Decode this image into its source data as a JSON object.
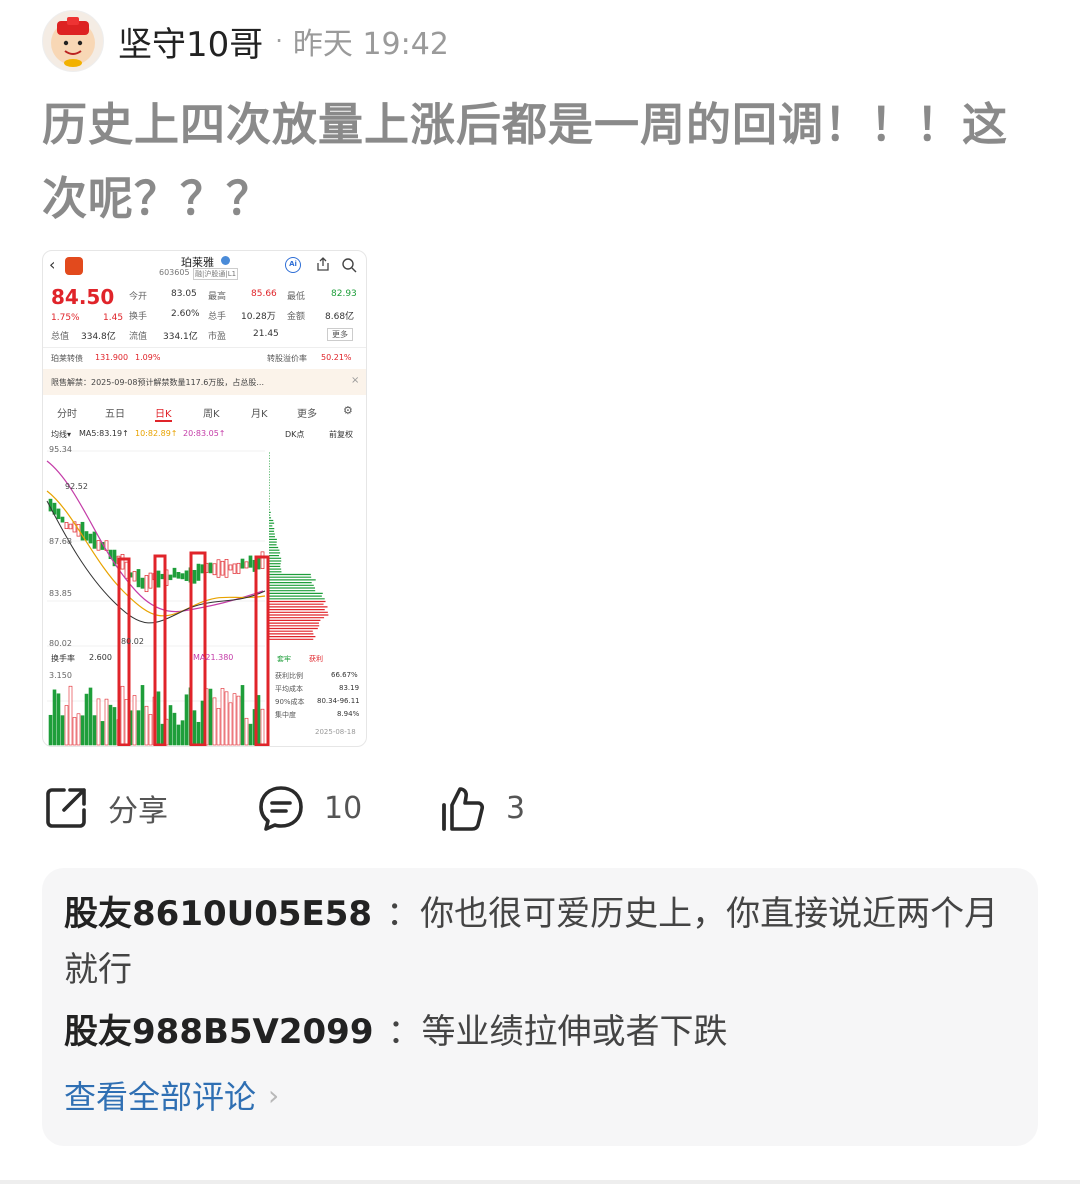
{
  "post": {
    "author": "坚守10哥",
    "separator": "·",
    "time": "昨天 19:42",
    "text": "历史上四次放量上涨后都是一周的回调！！！这次呢？？？"
  },
  "stock_screenshot": {
    "name": "珀莱雅",
    "code": "603605",
    "tag": "融|沪股通|L1",
    "price": "84.50",
    "change_pct": "1.75%",
    "change": "1.45",
    "open_label": "今开",
    "open": "83.05",
    "high_label": "最高",
    "high": "85.66",
    "low_label": "最低",
    "low": "82.93",
    "turnover_label": "换手",
    "turnover": "2.60%",
    "volume_label": "总手",
    "volume": "10.28万",
    "amount_label": "金额",
    "amount": "8.68亿",
    "mcap_label": "总值",
    "mcap": "334.8亿",
    "float_label": "流值",
    "float": "334.1亿",
    "pe_label": "市盈",
    "pe": "21.45",
    "more": "更多",
    "bond_label": "珀莱转债",
    "bond_price": "131.900",
    "bond_pct": "1.09%",
    "premium_label": "转股溢价率",
    "premium": "50.21%",
    "notice": "限售解禁：2025-09-08预计解禁数量117.6万股，占总股...",
    "tabs": [
      "分时",
      "五日",
      "日K",
      "周K",
      "月K",
      "更多"
    ],
    "ma_line": "MA5:83.19↑",
    "ma10": "10:82.89↑",
    "ma20": "20:83.05↑",
    "dk": "DK点",
    "fq": "前复权",
    "price_high": "95.34",
    "mark_high": "92.52",
    "price_mid": "87.68",
    "price_low2": "83.85",
    "price_low": "80.02",
    "mark_low": "80.02",
    "turnover_ind": "换手率",
    "turnover_val": "2.600",
    "ma_ind": "MA21.380",
    "vol_top": "3.150",
    "profit_rows": [
      {
        "label": "获利比例",
        "value": "66.67%"
      },
      {
        "label": "平均成本",
        "value": "83.19"
      },
      {
        "label": "90%成本",
        "value": "80.34-96.11"
      },
      {
        "label": "集中度",
        "value": "8.94%"
      }
    ],
    "legend_a": "套牢",
    "legend_b": "获利",
    "date": "2025-08-18",
    "accent_red": "#e0242a",
    "accent_green": "#1e9e3a"
  },
  "actions": {
    "share": "分享",
    "comment_count": "10",
    "like_count": "3"
  },
  "comments": [
    {
      "user": "股友8610U05E58",
      "sep": "：",
      "text": "你也很可爱历史上，你直接说近两个月就行"
    },
    {
      "user": "股友988B5V2099",
      "sep": "：",
      "text": "等业绩拉伸或者下跌"
    }
  ],
  "view_all": "查看全部评论"
}
